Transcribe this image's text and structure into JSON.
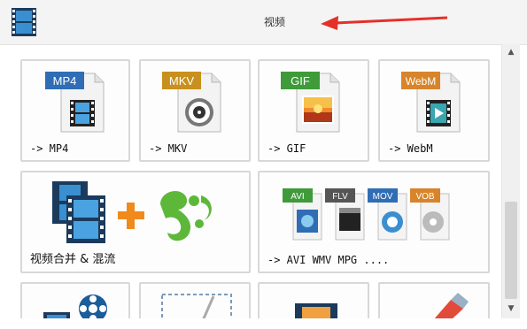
{
  "header": {
    "title": "视频",
    "icon": "film-strip-icon",
    "annotation": "red-arrow-icon"
  },
  "tiles": [
    {
      "badge": "MP4",
      "label": "-> MP4",
      "icon": "mp4-file-icon"
    },
    {
      "badge": "MKV",
      "label": "-> MKV",
      "icon": "mkv-file-icon"
    },
    {
      "badge": "GIF",
      "label": "-> GIF",
      "icon": "gif-file-icon"
    },
    {
      "badge": "WebM",
      "label": "-> WebM",
      "icon": "webm-file-icon"
    },
    {
      "label": "视频合并 & 混流",
      "icon": "video-merge-music-icon"
    },
    {
      "badges": [
        "AVI",
        "FLV",
        "MOV",
        "VOB"
      ],
      "label": "-> AVI WMV MPG ....",
      "icon": "multi-format-icon"
    }
  ],
  "colors": {
    "mp4": "#2f6db5",
    "mkv": "#c8901e",
    "gif": "#3f9a3a",
    "webm": "#d8842a",
    "arrow": "#e5302a"
  },
  "scrollbar": {
    "up": "▲",
    "down": "▼"
  }
}
